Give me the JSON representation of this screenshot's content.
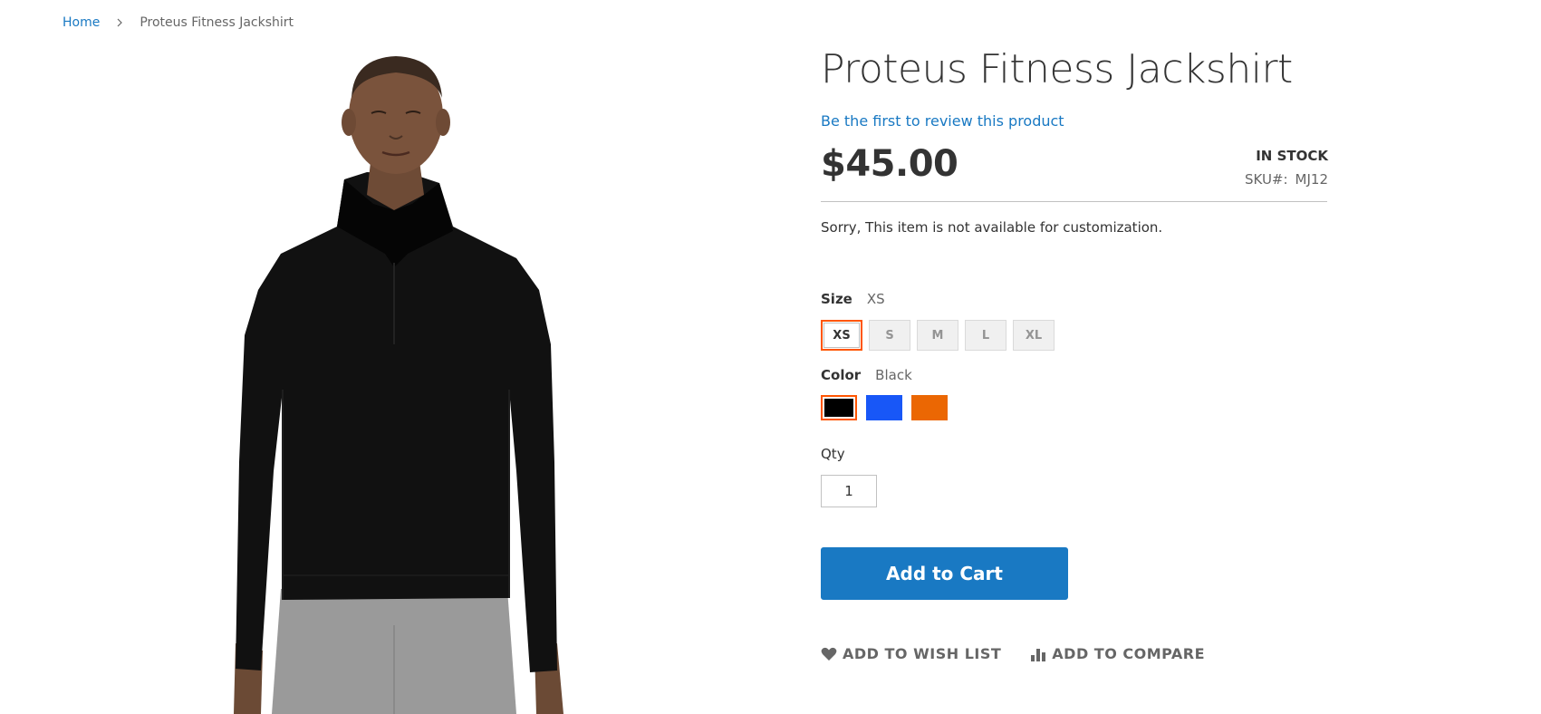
{
  "breadcrumb": {
    "home": "Home",
    "current": "Proteus Fitness Jackshirt"
  },
  "product": {
    "title": "Proteus Fitness Jackshirt",
    "review_link": "Be the first to review this product",
    "price": "$45.00",
    "stock_status": "IN STOCK",
    "sku_label": "SKU#:",
    "sku_value": "MJ12",
    "notice": "Sorry, This item is not available for customization.",
    "image_icon": "product-photo-man-black-jackshirt"
  },
  "size": {
    "label": "Size",
    "selected": "XS",
    "options": [
      "XS",
      "S",
      "M",
      "L",
      "XL"
    ]
  },
  "color": {
    "label": "Color",
    "selected": "Black",
    "options": [
      {
        "name": "Black",
        "hex": "#000000"
      },
      {
        "name": "Blue",
        "hex": "#1857f7"
      },
      {
        "name": "Orange",
        "hex": "#eb6703"
      }
    ]
  },
  "qty": {
    "label": "Qty",
    "value": "1"
  },
  "actions": {
    "add_to_cart": "Add to Cart",
    "wish_list": "ADD TO WISH LIST",
    "wish_list_icon": "heart-icon",
    "compare": "ADD TO COMPARE",
    "compare_icon": "bar-chart-icon"
  },
  "colors": {
    "accent": "#1979c3",
    "selected_border": "#ff5501"
  }
}
